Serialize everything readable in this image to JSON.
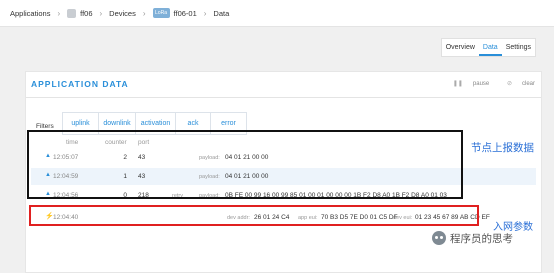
{
  "breadcrumb": {
    "items": [
      "Applications",
      "ff06",
      "Devices",
      "ff06-01",
      "Data"
    ],
    "device_badge": "LoRa"
  },
  "nav_tabs": [
    "Overview",
    "Data",
    "Settings"
  ],
  "active_tab": "Data",
  "panel": {
    "title": "APPLICATION DATA",
    "pause_label": "pause",
    "clear_label": "clear"
  },
  "filters": {
    "label": "Filters",
    "options": [
      "uplink",
      "downlink",
      "activation",
      "ack",
      "error"
    ]
  },
  "table": {
    "headers": {
      "time": "time",
      "counter": "counter",
      "port": "port"
    },
    "rows": [
      {
        "type": "uplink",
        "time": "12:05:07",
        "counter": "2",
        "port": "43",
        "flag": "",
        "payload_label": "payload:",
        "payload": "04 01 21 00 00"
      },
      {
        "type": "uplink",
        "time": "12:04:59",
        "counter": "1",
        "port": "43",
        "flag": "",
        "payload_label": "payload:",
        "payload": "04 01 21 00 00"
      },
      {
        "type": "uplink",
        "time": "12:04:56",
        "counter": "0",
        "port": "218",
        "flag": "retry",
        "payload_label": "payload:",
        "payload": "0B FE 00 99 16 00 99 85 01 00 01 00 00 00 1B F2 D8 A0 1B F2 D8 A0 01 03"
      }
    ],
    "activation": {
      "time": "12:04:40",
      "dev_addr_label": "dev addr:",
      "dev_addr": "26 01 24 C4",
      "app_eui_label": "app eui:",
      "app_eui": "70 B3 D5 7E D0 01 C5 DF",
      "dev_eui_label": "dev eui:",
      "dev_eui": "01 23 45 67 89 AB CD EF"
    }
  },
  "annotations": {
    "uplink_note": "节点上报数据",
    "join_note": "入网参数"
  },
  "watermark": "程序员的思考",
  "colors": {
    "accent": "#2a8fd9",
    "annotation": "#2a6fd6",
    "box_black": "#111111",
    "box_red": "#e02020",
    "activation_icon": "#e6b21e"
  },
  "icons": [
    "app-icon",
    "device-icon",
    "pause-icon",
    "clear-icon",
    "uplink-arrow-icon",
    "activation-bolt-icon",
    "wechat-logo-icon"
  ]
}
